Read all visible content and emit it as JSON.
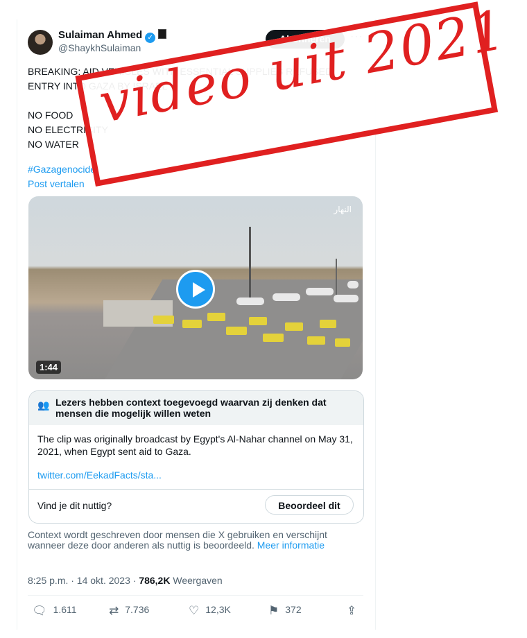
{
  "author": {
    "name": "Sulaiman Ahmed",
    "handle": "@ShaykhSulaiman"
  },
  "header": {
    "subscribe_label": "Abonneren",
    "more_label": "···"
  },
  "tweet": {
    "text_lines": [
      "BREAKING: AID VEHICLES WITH ESSENTIAL SUPPLIES REFUSED",
      "ENTRY INTO GAZA BY ISRAEL",
      "NO FOOD",
      "NO ELECTRICITY",
      "NO WATER"
    ],
    "hashtag": "#Gazagenocide",
    "translate_label": "Post vertalen"
  },
  "overlay_stamp": "video uit 2021",
  "video": {
    "duration": "1:44",
    "channel_logo": "النهار"
  },
  "community_note": {
    "title": "Lezers hebben context toegevoegd waarvan zij denken dat mensen die mogelijk willen weten",
    "body": "The clip was originally broadcast by Egypt's Al-Nahar channel on May 31, 2021, when Egypt sent aid to Gaza.",
    "link": "twitter.com/EekadFacts/sta...",
    "question": "Vind je dit nuttig?",
    "rate_label": "Beoordeel dit"
  },
  "disclaimer": {
    "text": "Context wordt geschreven door mensen die X gebruiken en verschijnt wanneer deze door anderen als nuttig is beoordeeld.",
    "more_info": "Meer informatie"
  },
  "meta": {
    "time": "8:25 p.m. · 14 okt. 2023 ·",
    "views_count": "786,2K",
    "views_label": "Weergaven"
  },
  "actions": {
    "replies": "1.611",
    "reposts": "7.736",
    "likes": "12,3K",
    "bookmarks": "372"
  },
  "colors": {
    "accent": "#1d9bf0",
    "stamp": "#e02020",
    "text": "#0f1419",
    "muted": "#536471"
  }
}
